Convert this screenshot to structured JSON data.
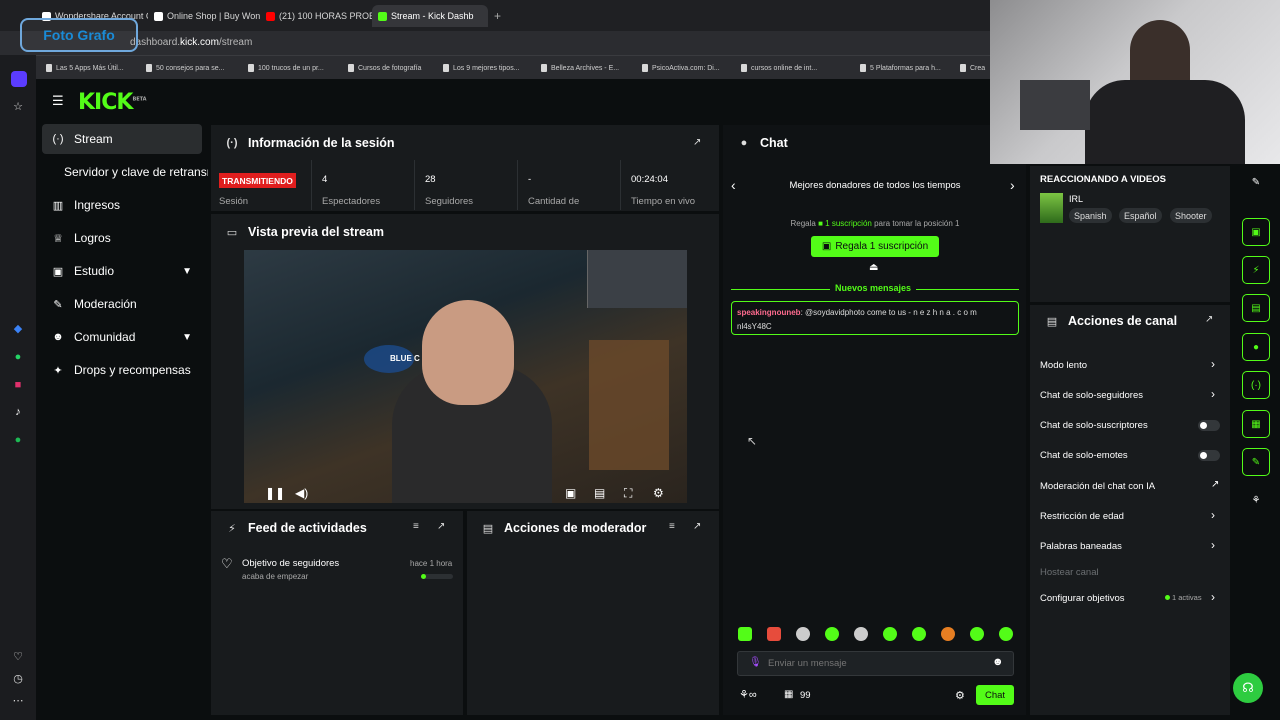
{
  "browser": {
    "tabs": [
      {
        "label": "Wondershare Account C"
      },
      {
        "label": "Online Shop | Buy Wond"
      },
      {
        "label": "(21) 100 HORAS PROBA"
      },
      {
        "label": "Stream - Kick Dashb"
      }
    ],
    "url_prefix": "dashboard.",
    "url_domain": "kick.com",
    "url_path": "/stream",
    "bookmarks": [
      "Las 5 Apps Más Útil...",
      "50 consejos para se...",
      "100 trucos de un pr...",
      "Cursos de fotografía",
      "Los 9 mejores tipos...",
      "Belleza Archives - E...",
      "PsicoActiva.com: Di...",
      "cursos online de int...",
      "5 Plataformas para h...",
      "Crea"
    ],
    "watermark": "Foto Grafo"
  },
  "colors": {
    "accent": "#53fc18",
    "live": "#e01e1e",
    "panel": "#181b1d",
    "background": "#0b0e0f"
  },
  "app": {
    "logo": "KICK",
    "logo_sup": "BETA"
  },
  "nav": {
    "items": [
      {
        "label": "Stream",
        "icon": "signal-icon"
      },
      {
        "label": "Servidor y clave de retransmisión"
      },
      {
        "label": "Ingresos",
        "icon": "chart-icon"
      },
      {
        "label": "Logros",
        "icon": "trophy-icon"
      },
      {
        "label": "Estudio",
        "icon": "camera-icon"
      },
      {
        "label": "Moderación",
        "icon": "wrench-icon"
      },
      {
        "label": "Comunidad",
        "icon": "users-icon"
      },
      {
        "label": "Drops y recompensas",
        "icon": "gift-icon"
      }
    ]
  },
  "session": {
    "title": "Información de la sesión",
    "live_label": "TRANSMITIENDO",
    "session_label": "Sesión",
    "stats": [
      {
        "value": "4",
        "label": "Espectadores"
      },
      {
        "value": "28",
        "label": "Seguidores"
      },
      {
        "value": "-",
        "label": "Cantidad de"
      },
      {
        "value": "00:24:04",
        "label": "Tiempo en vivo"
      }
    ]
  },
  "preview": {
    "title": "Vista previa del stream",
    "overlay_text": "BLUE C"
  },
  "activity": {
    "title": "Feed de actividades",
    "items": [
      {
        "title": "Objetivo de seguidores",
        "subtitle": "acaba de empezar",
        "time": "hace 1 hora",
        "progress": 0.15
      }
    ]
  },
  "mod_actions": {
    "title": "Acciones de moderador"
  },
  "chat": {
    "title": "Chat",
    "top_donors_title": "Mejores donadores de todos los tiempos",
    "gift_prefix": "Regala",
    "gift_highlight": "1 suscripción",
    "gift_suffix": "para tomar la posición 1",
    "gift_button": "Regala 1 suscripción",
    "new_messages": "Nuevos mensajes",
    "messages": [
      {
        "user": "speakingnouneb",
        "text": "@soydavidphoto come to us - n e z h n a . c o m nl4sY48C"
      }
    ],
    "input_placeholder": "Enviar un mensaje",
    "points": "99",
    "send_label": "Chat"
  },
  "stream_info": {
    "title": "REACCIONANDO A VIDEOS",
    "category": "IRL",
    "tags": [
      "Spanish",
      "Español",
      "Shooter"
    ]
  },
  "channel_actions": {
    "title": "Acciones de canal",
    "rows": [
      {
        "label": "Modo lento",
        "control": "chevron"
      },
      {
        "label": "Chat de solo-seguidores",
        "control": "chevron"
      },
      {
        "label": "Chat de solo-suscriptores",
        "control": "toggle"
      },
      {
        "label": "Chat de solo-emotes",
        "control": "toggle"
      },
      {
        "label": "Moderación del chat con IA",
        "control": "external"
      },
      {
        "label": "Restricción de edad",
        "control": "chevron"
      },
      {
        "label": "Palabras baneadas",
        "control": "chevron"
      },
      {
        "label": "Hostear canal",
        "control": "none"
      },
      {
        "label": "Configurar objetivos",
        "control": "chevron",
        "badge": "1 activas"
      }
    ]
  }
}
